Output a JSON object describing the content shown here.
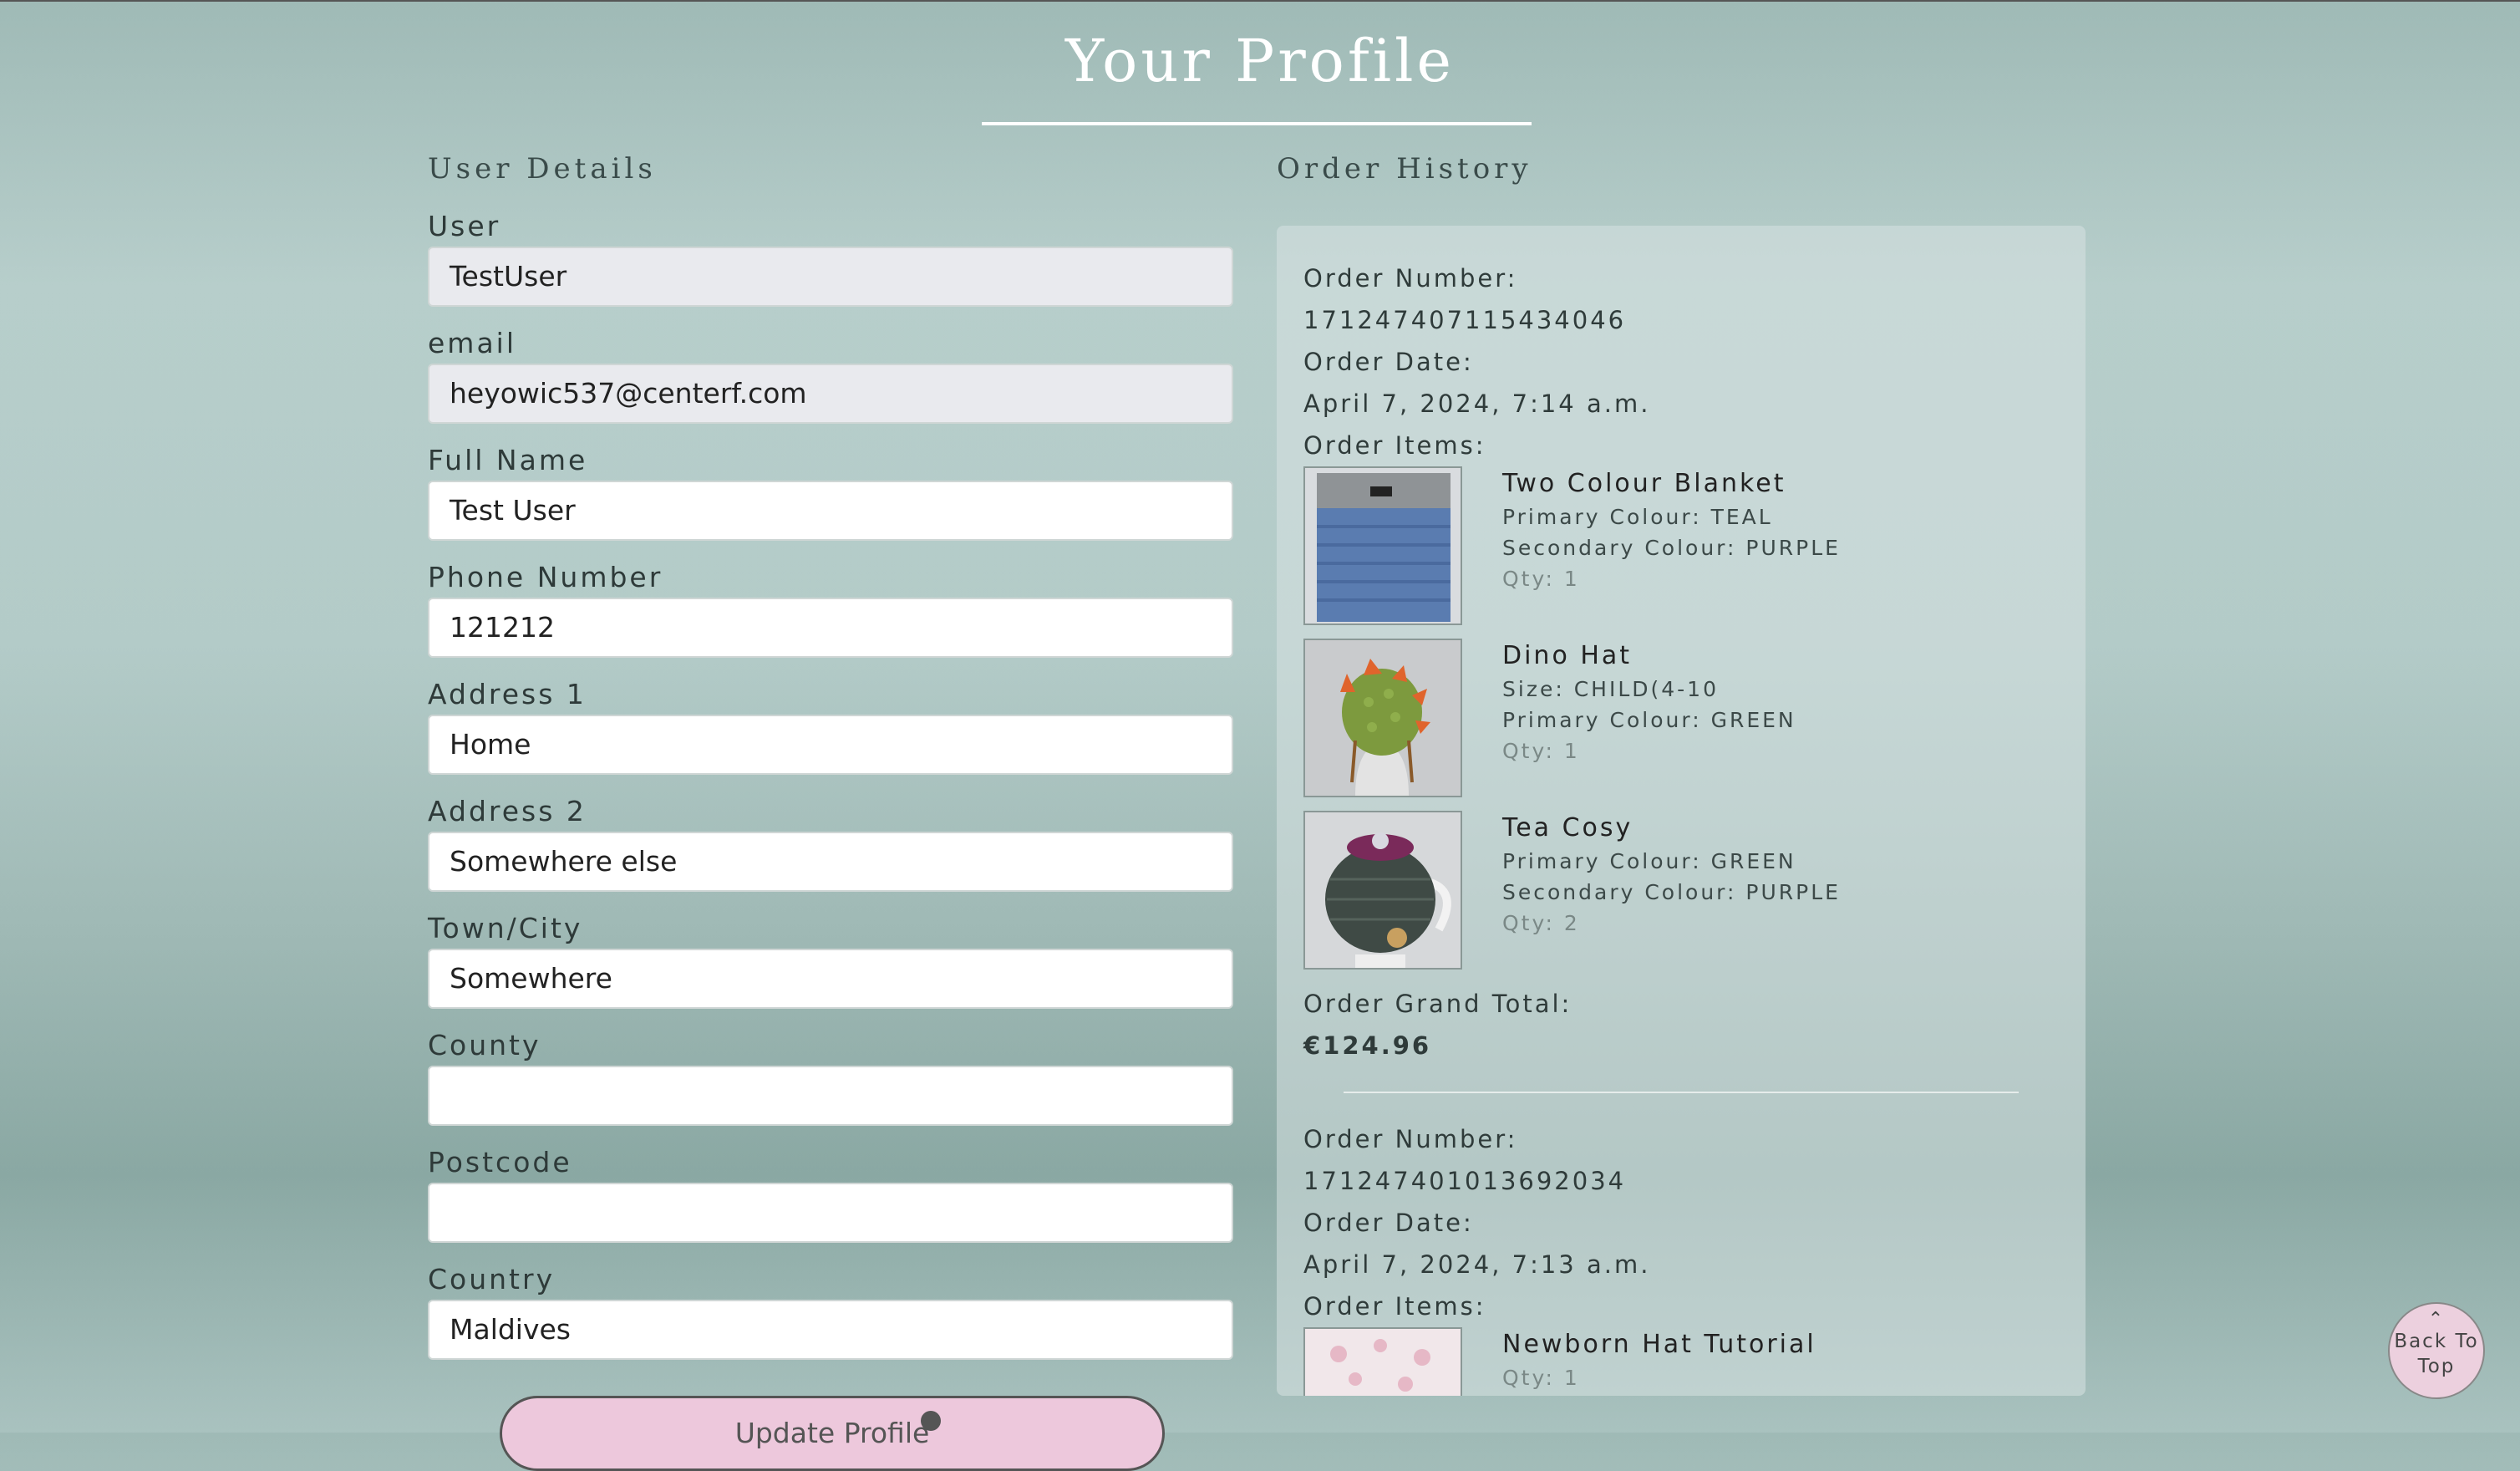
{
  "page": {
    "title": "Your Profile"
  },
  "user_details": {
    "heading": "User Details",
    "fields": [
      {
        "label": "User",
        "value": "TestUser",
        "readonly": true
      },
      {
        "label": "email",
        "value": "heyowic537@centerf.com",
        "readonly": true
      },
      {
        "label": "Full Name",
        "value": "Test User"
      },
      {
        "label": "Phone Number",
        "value": "121212"
      },
      {
        "label": "Address 1",
        "value": "Home"
      },
      {
        "label": "Address 2",
        "value": "Somewhere else"
      },
      {
        "label": "Town/City",
        "value": "Somewhere"
      },
      {
        "label": "County",
        "value": ""
      },
      {
        "label": "Postcode",
        "value": ""
      },
      {
        "label": "Country",
        "value": "Maldives"
      }
    ],
    "update_button": "Update Profile"
  },
  "order_history": {
    "heading": "Order History",
    "labels": {
      "order_number": "Order Number:",
      "order_date": "Order Date:",
      "order_items": "Order Items:",
      "grand_total": "Order Grand Total:"
    },
    "orders": [
      {
        "number": "171247407115434046",
        "date": "April 7, 2024, 7:14 a.m.",
        "items": [
          {
            "name": "Two Colour Blanket",
            "attrs": [
              "Primary Colour: TEAL",
              "Secondary Colour: PURPLE"
            ],
            "qty": "Qty: 1",
            "image": "blanket-image"
          },
          {
            "name": "Dino Hat",
            "attrs": [
              "Size: CHILD(4-10",
              "Primary Colour: GREEN"
            ],
            "qty": "Qty: 1",
            "image": "dino-hat-image"
          },
          {
            "name": "Tea Cosy",
            "attrs": [
              "Primary Colour: GREEN",
              "Secondary Colour: PURPLE"
            ],
            "qty": "Qty: 2",
            "image": "tea-cosy-image"
          }
        ],
        "grand_total": "€124.96"
      },
      {
        "number": "171247401013692034",
        "date": "April 7, 2024, 7:13 a.m.",
        "items": [
          {
            "name": "Newborn Hat Tutorial",
            "attrs": [],
            "qty": "Qty: 1",
            "image": "newborn-hat-image"
          }
        ]
      }
    ]
  },
  "back_to_top": {
    "icon": "chevron-up-icon",
    "line1": "Back To",
    "line2": "Top"
  },
  "colors": {
    "accent_button": "#edc8dc",
    "title_text": "#ffffff"
  }
}
